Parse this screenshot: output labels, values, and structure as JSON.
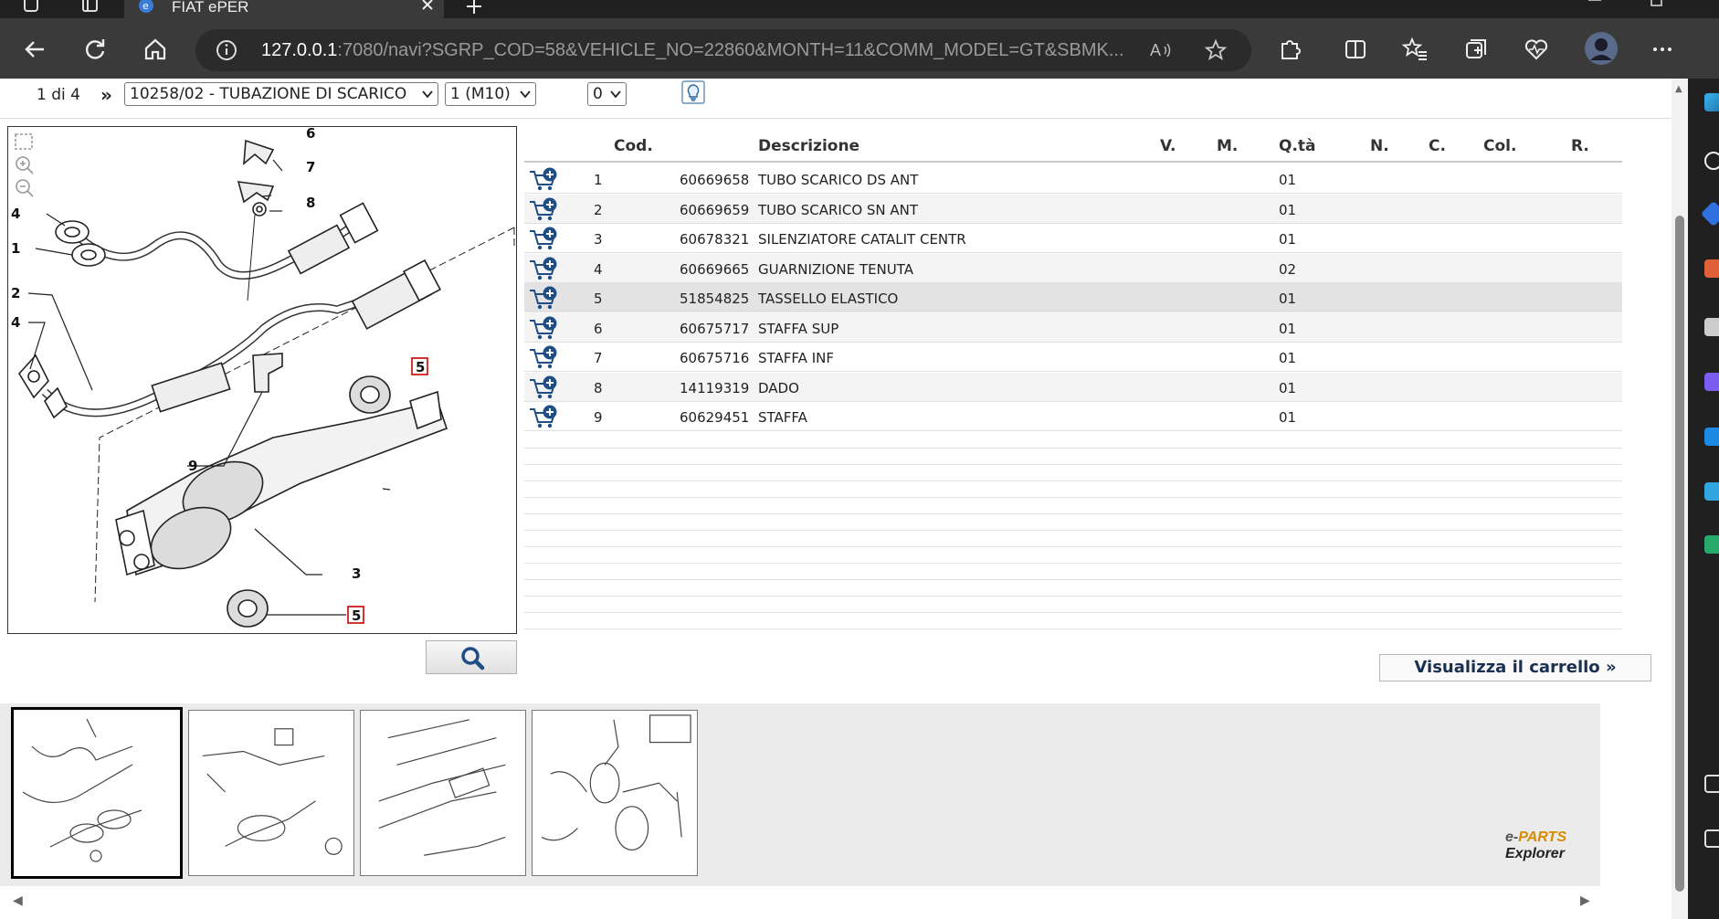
{
  "browser": {
    "tab_title": "FIAT ePER",
    "url_host": "127.0.0.1",
    "url_rest": ":7080/navi?SGRP_COD=58&VEHICLE_NO=22860&MONTH=11&COMM_MODEL=GT&SBMK..."
  },
  "nav": {
    "page_indicator": "1 di 4",
    "next_label": "»",
    "group_select": "10258/02 - TUBAZIONE DI SCARICO",
    "variant_select": "1 (M10)",
    "count_select": "0"
  },
  "diagram": {
    "callouts": [
      "1",
      "2",
      "3",
      "4",
      "4",
      "5",
      "5",
      "6",
      "7",
      "8",
      "9"
    ]
  },
  "table": {
    "headers": {
      "cod": "Cod.",
      "descrizione": "Descrizione",
      "v": "V.",
      "m": "M.",
      "qta": "Q.tà",
      "n": "N.",
      "c": "C.",
      "col": "Col.",
      "r": "R."
    },
    "rows": [
      {
        "num": "1",
        "code": "60669658",
        "desc": "TUBO SCARICO DS ANT",
        "qty": "01"
      },
      {
        "num": "2",
        "code": "60669659",
        "desc": "TUBO SCARICO SN ANT",
        "qty": "01"
      },
      {
        "num": "3",
        "code": "60678321",
        "desc": "SILENZIATORE CATALIT CENTR",
        "qty": "01"
      },
      {
        "num": "4",
        "code": "60669665",
        "desc": "GUARNIZIONE TENUTA",
        "qty": "02"
      },
      {
        "num": "5",
        "code": "51854825",
        "desc": "TASSELLO ELASTICO",
        "qty": "01"
      },
      {
        "num": "6",
        "code": "60675717",
        "desc": "STAFFA SUP",
        "qty": "01"
      },
      {
        "num": "7",
        "code": "60675716",
        "desc": "STAFFA INF",
        "qty": "01"
      },
      {
        "num": "8",
        "code": "14119319",
        "desc": "DADO",
        "qty": "01"
      },
      {
        "num": "9",
        "code": "60629451",
        "desc": "STAFFA",
        "qty": "01"
      }
    ]
  },
  "cart_button": "Visualizza il carrello »",
  "brand": {
    "e": "e-",
    "parts": "PARTS",
    "explorer": " Explorer"
  }
}
